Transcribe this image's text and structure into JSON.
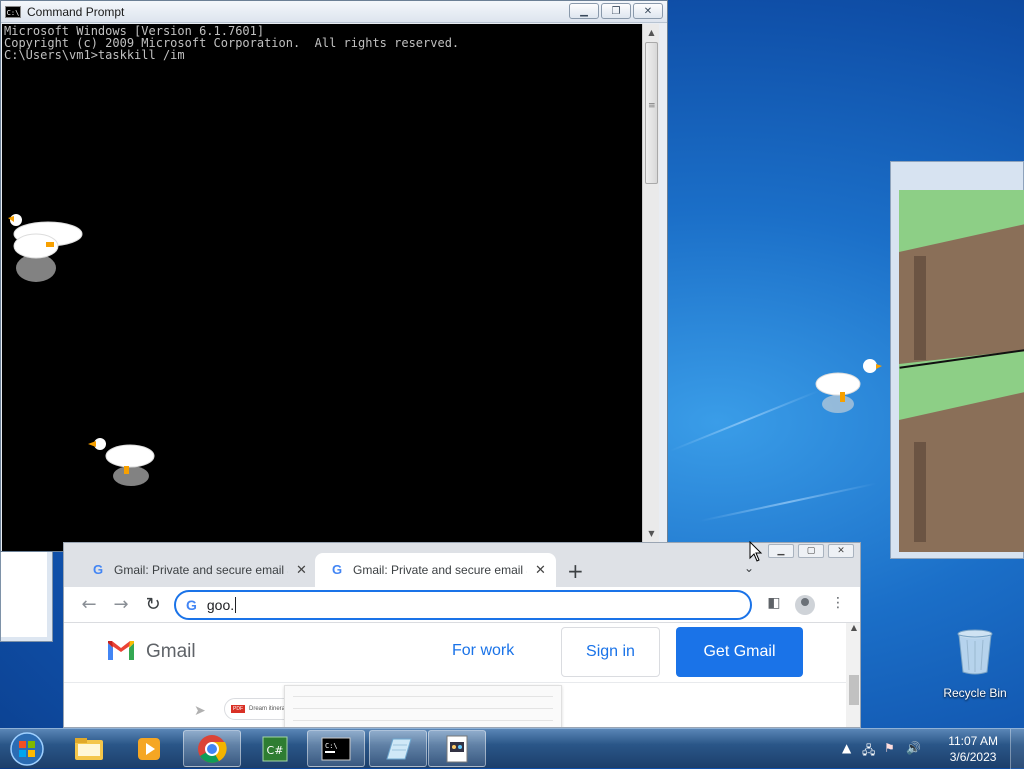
{
  "cmd": {
    "title": "Command Prompt",
    "line1": "Microsoft Windows [Version 6.1.7601]",
    "line2": "Copyright (c) 2009 Microsoft Corporation.  All rights reserved.",
    "line3": "",
    "line4": "C:\\Users\\vm1>taskkill /im"
  },
  "chrome": {
    "tabs": [
      {
        "label": "Gmail: Private and secure email at no cost"
      },
      {
        "label": "Gmail: Private and secure email at no cost"
      }
    ],
    "omnibox_value": "goo.",
    "page": {
      "brand": "Gmail",
      "for_work": "For work",
      "sign_in": "Sign in",
      "get_gmail": "Get Gmail",
      "preview_attachment": "Dream itinerary"
    }
  },
  "desktop": {
    "recycle_bin_label": "Recycle Bin"
  },
  "taskbar": {
    "time": "11:07 AM",
    "date": "3/6/2023"
  },
  "colors": {
    "accent_blue": "#1a73e8",
    "console_bg": "#000000",
    "console_text": "#c0c0c0"
  }
}
